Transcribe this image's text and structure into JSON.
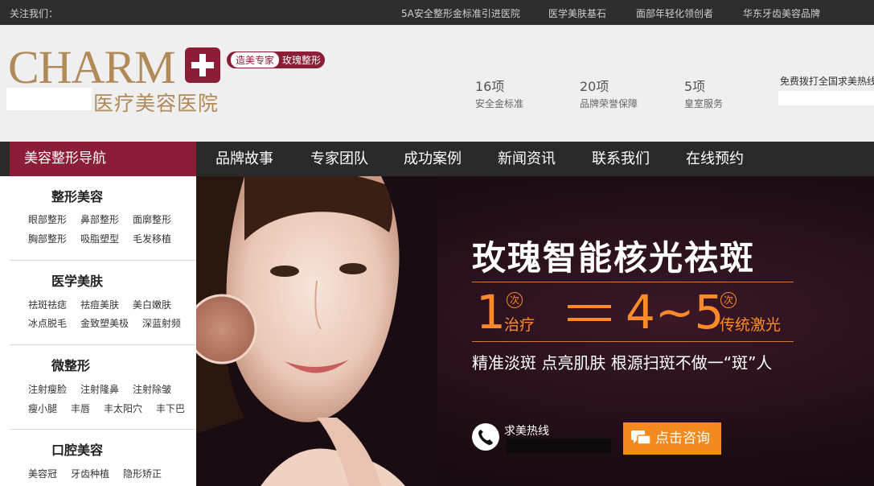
{
  "topbar": {
    "follow": "关注我们：",
    "links": [
      "5A安全整形金标准引进医院",
      "医学美肤基石",
      "面部年轻化领创者",
      "华东牙齿美容品牌"
    ]
  },
  "header": {
    "logo_en": "CHARM",
    "logo_cn": "医疗美容医院",
    "badge_left": "造美专家",
    "badge_right": "玫瑰整形",
    "stats": [
      {
        "num": "16项",
        "label": "安全金标准"
      },
      {
        "num": "20项",
        "label": "品牌荣誉保障"
      },
      {
        "num": "5项",
        "label": "皇室服务"
      }
    ],
    "hotline_label": "免费拨打全国求美热线"
  },
  "nav": {
    "title": "美容整形导航",
    "items": [
      "品牌故事",
      "专家团队",
      "成功案例",
      "新闻资讯",
      "联系我们",
      "在线预约"
    ]
  },
  "sidebar": {
    "categories": [
      {
        "title": "整形美容",
        "rows": [
          [
            "眼部整形",
            "鼻部整形",
            "面廓整形"
          ],
          [
            "胸部整形",
            "吸脂塑型",
            "毛发移植"
          ]
        ]
      },
      {
        "title": "医学美肤",
        "rows": [
          [
            "祛斑祛痣",
            "祛痘美肤",
            "美白嫩肤"
          ],
          [
            "冰点脱毛",
            "金致塑美极",
            "深蓝射频"
          ]
        ]
      },
      {
        "title": "微整形",
        "rows": [
          [
            "注射瘦脸",
            "注射隆鼻",
            "注射除皱"
          ],
          [
            "瘦小腿",
            "丰唇",
            "丰太阳穴",
            "丰下巴"
          ]
        ]
      },
      {
        "title": "口腔美容",
        "rows": [
          [
            "美容冠",
            "牙齿种植",
            "隐形矫正"
          ]
        ]
      }
    ]
  },
  "banner": {
    "title": "玫瑰智能核光祛斑",
    "left_num": "1",
    "left_circle": "次",
    "left_text": "治疗",
    "right_num": "4~5",
    "right_circle": "次",
    "right_text": "传统激光",
    "subtitle": "精准淡斑 点亮肌肤 根源扫斑不做一“斑”人",
    "hotline_label": "求美热线",
    "consult_label": "点击咨询",
    "accent_color": "#ff8a2a",
    "brand_color": "#8b1e36"
  }
}
